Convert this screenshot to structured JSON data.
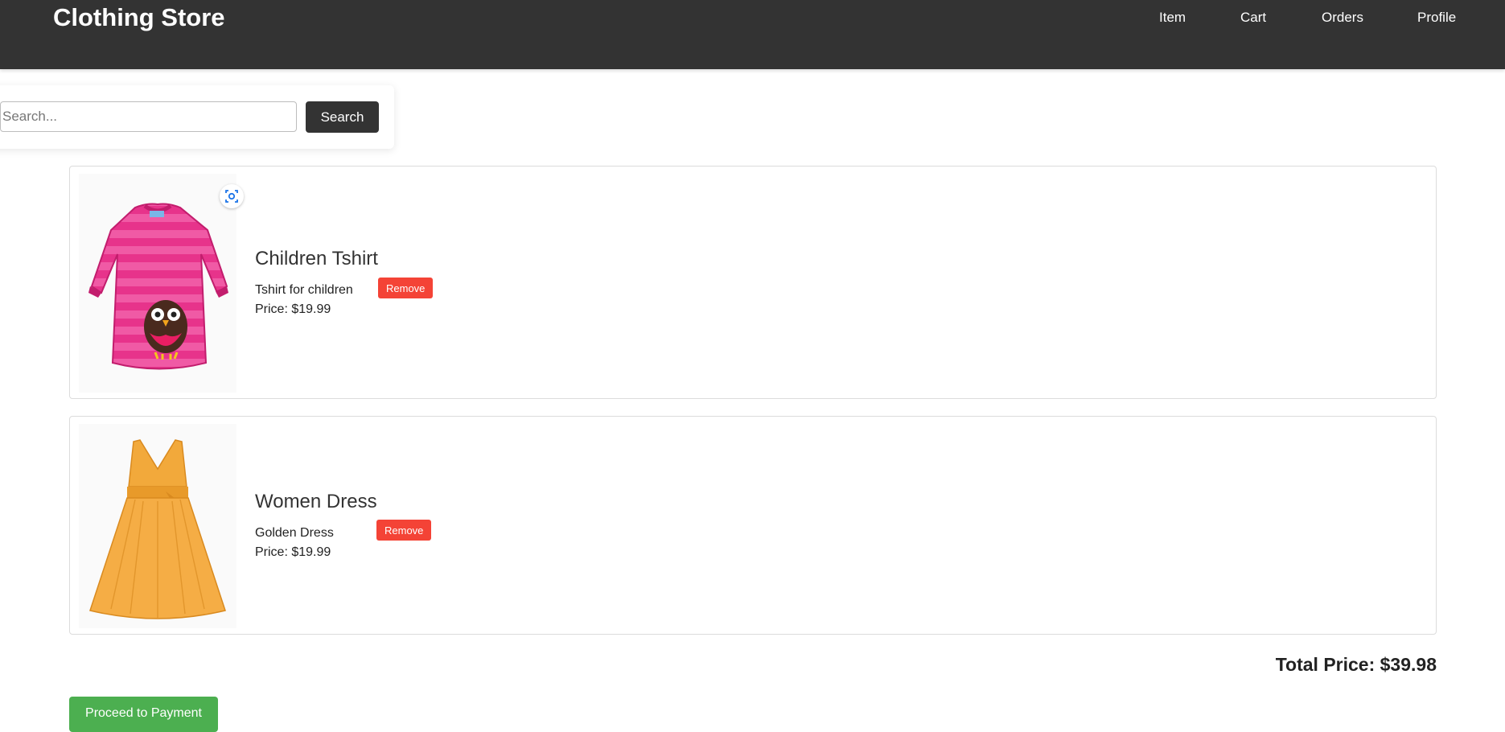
{
  "header": {
    "brand": "Clothing Store",
    "nav": [
      {
        "label": "Item"
      },
      {
        "label": "Cart"
      },
      {
        "label": "Orders"
      },
      {
        "label": "Profile"
      }
    ]
  },
  "search": {
    "placeholder": "Search...",
    "value": "",
    "button_label": "Search"
  },
  "cart": {
    "items": [
      {
        "title": "Children Tshirt",
        "description": "Tshirt for children",
        "price": "Price: $19.99",
        "remove_label": "Remove",
        "image_icon": "pink-striped-owl-dress-image"
      },
      {
        "title": "Women Dress",
        "description": "Golden Dress",
        "price": "Price: $19.99",
        "remove_label": "Remove",
        "image_icon": "golden-dress-image"
      }
    ],
    "total": "Total Price: $39.98",
    "pay_label": "Proceed to Payment"
  },
  "colors": {
    "header_bg": "#333333",
    "remove_button": "#f44336",
    "pay_button": "#4caf50"
  }
}
